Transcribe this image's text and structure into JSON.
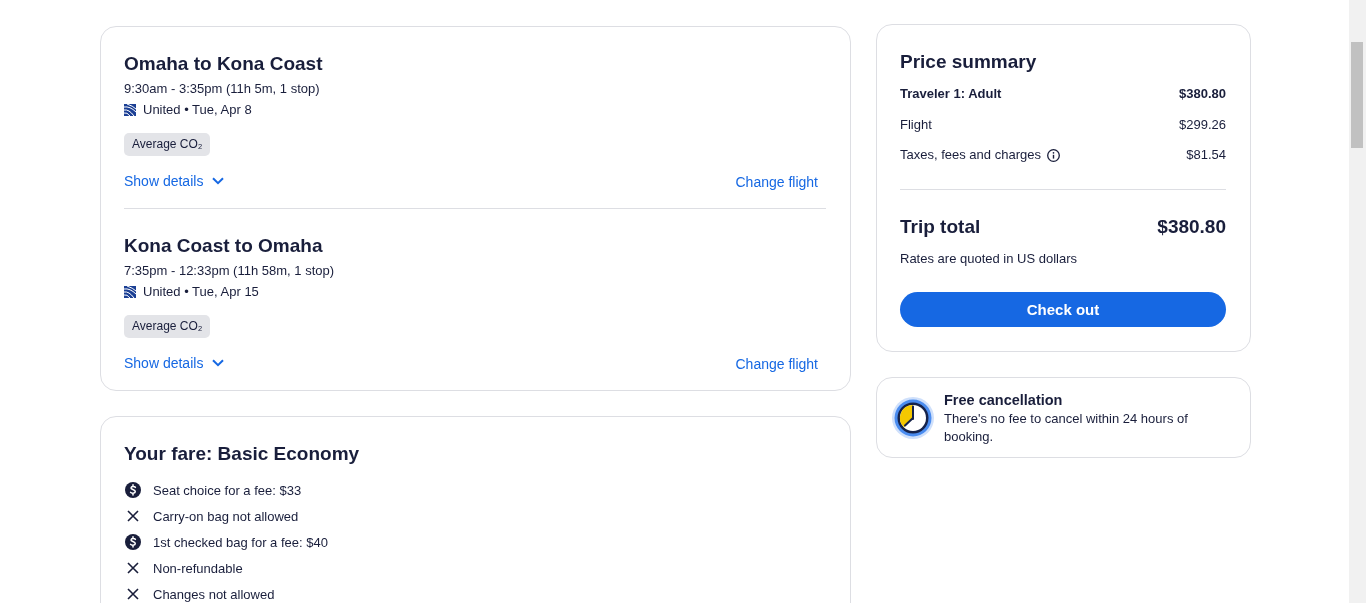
{
  "flights": [
    {
      "title": "Omaha to Kona Coast",
      "times": "9:30am - 3:35pm (11h 5m, 1 stop)",
      "airline_line": "United • Tue, Apr 8",
      "badge": "Average CO₂",
      "details_link": "Show details",
      "expanded": false,
      "change_link": "Change flight"
    },
    {
      "title": "Kona Coast to Omaha",
      "times": "7:35pm - 12:33pm (11h 58m, 1 stop)",
      "airline_line": "United • Tue, Apr 15",
      "badge": "Average CO₂",
      "details_link": "Show details",
      "expanded": false,
      "change_link": "Change flight"
    }
  ],
  "fare": {
    "title": "Your fare: Basic Economy",
    "items": [
      {
        "kind": "fee",
        "text": "Seat choice for a fee: $33"
      },
      {
        "kind": "excluded",
        "text": "Carry-on bag not allowed"
      },
      {
        "kind": "fee",
        "text": "1st checked bag for a fee: $40"
      },
      {
        "kind": "excluded",
        "text": "Non-refundable"
      },
      {
        "kind": "excluded",
        "text": "Changes not allowed"
      }
    ]
  },
  "price_summary": {
    "title": "Price summary",
    "lines": [
      {
        "kind": "traveler",
        "label": "Traveler 1: Adult",
        "amount": "$380.80",
        "info": false
      },
      {
        "kind": "charge",
        "label": "Flight",
        "amount": "$299.26",
        "info": false
      },
      {
        "kind": "charge",
        "label": "Taxes, fees and charges",
        "amount": "$81.54",
        "info": true
      }
    ],
    "total_label": "Trip total",
    "total": "$380.80",
    "note": "Rates are quoted in US dollars",
    "button": "Check out"
  },
  "cancellation": {
    "title": "Free cancellation",
    "text": "There's no fee to cancel within 24 hours of booking."
  }
}
